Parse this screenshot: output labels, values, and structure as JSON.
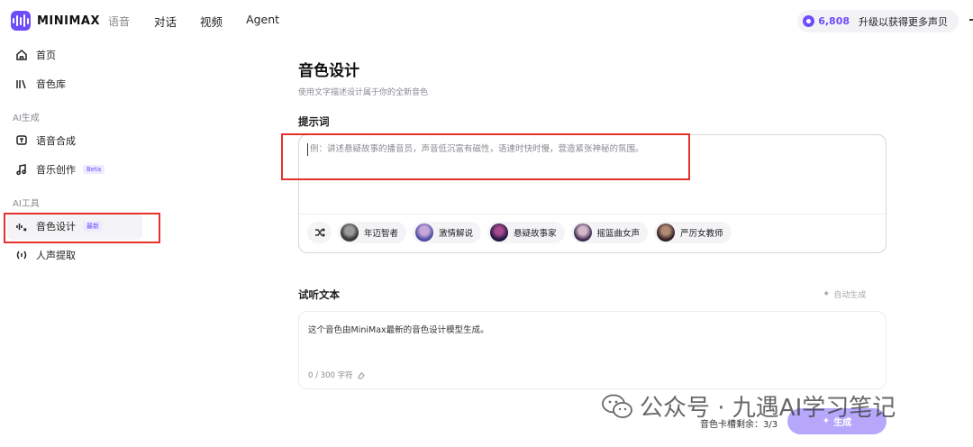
{
  "header": {
    "logo_text": "MINIMAX",
    "logo_sub": "语音",
    "nav": [
      "对话",
      "视频",
      "Agent"
    ],
    "credits": "6,808",
    "upgrade_label": "升级以获得更多声贝",
    "accent_color": "#6d4dfa"
  },
  "sidebar": {
    "items": [
      {
        "label": "首页",
        "icon": "home-icon"
      },
      {
        "label": "音色库",
        "icon": "library-icon"
      }
    ],
    "section_ai_gen": "AI生成",
    "gen_items": [
      {
        "label": "语音合成",
        "icon": "tts-icon"
      },
      {
        "label": "音乐创作",
        "icon": "music-icon",
        "badge": "Beta"
      }
    ],
    "section_ai_tools": "AI工具",
    "tool_items": [
      {
        "label": "音色设计",
        "icon": "voice-design-icon",
        "badge": "最新",
        "active": true
      },
      {
        "label": "人声提取",
        "icon": "vocal-extract-icon"
      }
    ]
  },
  "main": {
    "title": "音色设计",
    "subtitle": "使用文字描述设计属于你的全新音色",
    "prompt_heading": "提示词",
    "prompt_placeholder": "例：讲述悬疑故事的播音员，声音低沉富有磁性，语速时快时慢，营造紧张神秘的氛围。",
    "presets": [
      "年迈智者",
      "激情解说",
      "悬疑故事家",
      "摇篮曲女声",
      "严厉女教师"
    ],
    "listen_heading": "试听文本",
    "auto_generate": "自动生成",
    "listen_text": "这个音色由MiniMax最新的音色设计模型生成。",
    "char_counter": "0 / 300 字符",
    "card_remaining": "音色卡槽剩余：3/3",
    "generate_label": "生成"
  },
  "watermark": "公众号 · 九遇AI学习笔记"
}
